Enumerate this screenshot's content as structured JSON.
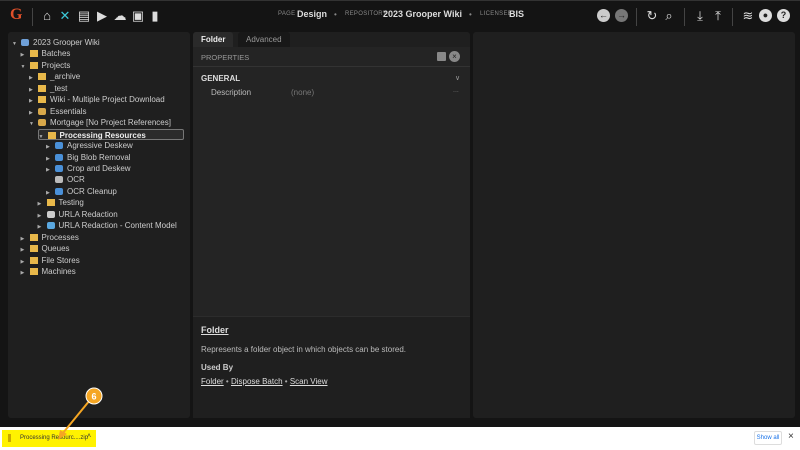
{
  "header": {
    "logo": "G",
    "icons": [
      "home-icon",
      "tools-icon",
      "archive-icon",
      "play-box-icon",
      "cloud-upload-icon",
      "briefcase-clock-icon",
      "chart-bar-icon"
    ],
    "page_label": "PAGE",
    "page_value": "Design",
    "repository_label": "REPOSITORY",
    "repository_value": "2023 Grooper Wiki",
    "licensee_label": "LICENSEE",
    "licensee_value": "BIS",
    "right_icons": [
      "back-icon",
      "forward-icon",
      "refresh-icon",
      "search-icon",
      "download-icon",
      "upload-icon",
      "database-icon",
      "account-icon",
      "help-icon"
    ]
  },
  "tree": [
    {
      "label": "2023 Grooper Wiki",
      "level": 0,
      "expanded": true,
      "icon": "repository"
    },
    {
      "label": "Batches",
      "level": 1,
      "expanded": false,
      "icon": "folder"
    },
    {
      "label": "Projects",
      "level": 1,
      "expanded": true,
      "icon": "folder"
    },
    {
      "label": "_archive",
      "level": 2,
      "expanded": false,
      "icon": "folder"
    },
    {
      "label": "_test",
      "level": 2,
      "expanded": false,
      "icon": "folder"
    },
    {
      "label": "Wiki - Multiple Project Download",
      "level": 2,
      "expanded": false,
      "icon": "folder"
    },
    {
      "label": "Essentials",
      "level": 2,
      "expanded": false,
      "icon": "project"
    },
    {
      "label": "Mortgage [No Project References]",
      "level": 2,
      "expanded": true,
      "icon": "project"
    },
    {
      "label": "Processing Resources",
      "level": 3,
      "expanded": true,
      "icon": "folder",
      "selected": true
    },
    {
      "label": "Agressive Deskew",
      "level": 4,
      "expanded": false,
      "icon": "ip-profile"
    },
    {
      "label": "Big Blob Removal",
      "level": 4,
      "expanded": false,
      "icon": "ip-profile"
    },
    {
      "label": "Crop and Deskew",
      "level": 4,
      "expanded": false,
      "icon": "ip-profile"
    },
    {
      "label": "OCR",
      "level": 4,
      "icon": "ocr-profile"
    },
    {
      "label": "OCR Cleanup",
      "level": 4,
      "expanded": false,
      "icon": "ip-profile"
    },
    {
      "label": "Testing",
      "level": 3,
      "expanded": false,
      "icon": "folder"
    },
    {
      "label": "URLA Redaction",
      "level": 3,
      "expanded": false,
      "icon": "gear"
    },
    {
      "label": "URLA Redaction - Content Model",
      "level": 3,
      "expanded": false,
      "icon": "content-model"
    },
    {
      "label": "Processes",
      "level": 1,
      "expanded": false,
      "icon": "folder"
    },
    {
      "label": "Queues",
      "level": 1,
      "expanded": false,
      "icon": "folder"
    },
    {
      "label": "File Stores",
      "level": 1,
      "expanded": false,
      "icon": "folder"
    },
    {
      "label": "Machines",
      "level": 1,
      "expanded": false,
      "icon": "folder"
    }
  ],
  "editor": {
    "tabs": [
      {
        "label": "Folder",
        "active": true
      },
      {
        "label": "Advanced",
        "active": false
      }
    ],
    "properties_label": "PROPERTIES",
    "section": "GENERAL",
    "property_name": "Description",
    "property_value": "(none)",
    "ellipsis": "...",
    "help_title": "Folder",
    "help_text": "Represents a folder object in which objects can be stored.",
    "used_by_label": "Used By",
    "used_by": [
      "Folder",
      "Dispose Batch",
      "Scan View"
    ],
    "separator": "•"
  },
  "annotation": {
    "number": "6",
    "color": "#f5a623"
  },
  "download_bar": {
    "file": "Processing Resourc....zip",
    "show_all": "Show all",
    "close": "×",
    "highlight": "#fff200"
  }
}
